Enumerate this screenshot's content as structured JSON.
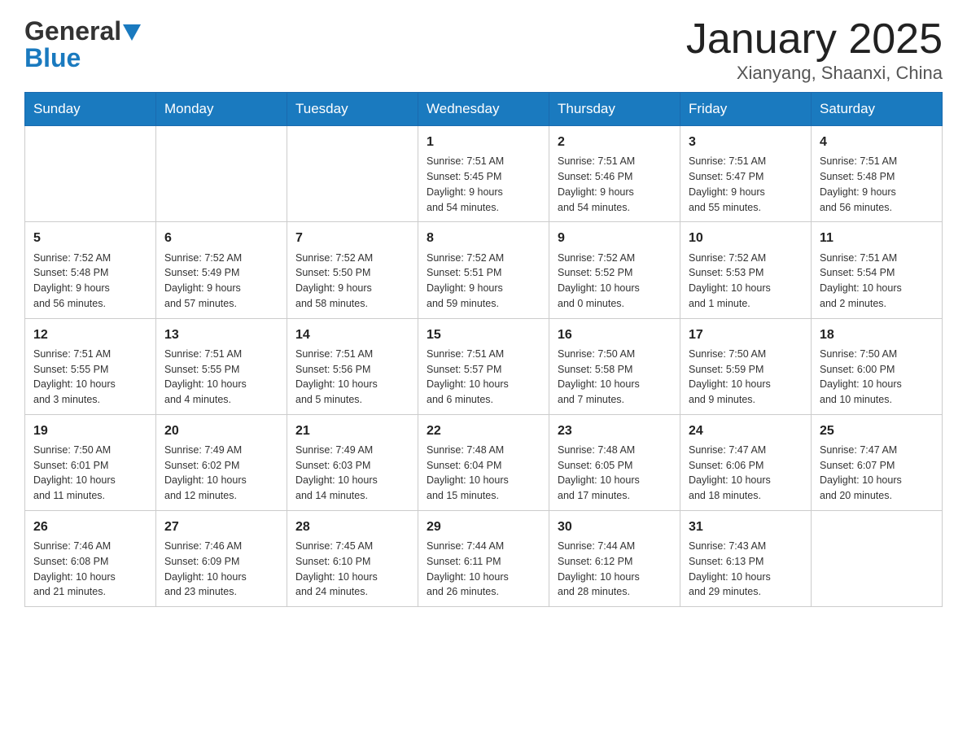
{
  "header": {
    "logo_general": "General",
    "logo_blue": "Blue",
    "title": "January 2025",
    "subtitle": "Xianyang, Shaanxi, China"
  },
  "days_of_week": [
    "Sunday",
    "Monday",
    "Tuesday",
    "Wednesday",
    "Thursday",
    "Friday",
    "Saturday"
  ],
  "weeks": [
    [
      {
        "day": "",
        "info": ""
      },
      {
        "day": "",
        "info": ""
      },
      {
        "day": "",
        "info": ""
      },
      {
        "day": "1",
        "info": "Sunrise: 7:51 AM\nSunset: 5:45 PM\nDaylight: 9 hours\nand 54 minutes."
      },
      {
        "day": "2",
        "info": "Sunrise: 7:51 AM\nSunset: 5:46 PM\nDaylight: 9 hours\nand 54 minutes."
      },
      {
        "day": "3",
        "info": "Sunrise: 7:51 AM\nSunset: 5:47 PM\nDaylight: 9 hours\nand 55 minutes."
      },
      {
        "day": "4",
        "info": "Sunrise: 7:51 AM\nSunset: 5:48 PM\nDaylight: 9 hours\nand 56 minutes."
      }
    ],
    [
      {
        "day": "5",
        "info": "Sunrise: 7:52 AM\nSunset: 5:48 PM\nDaylight: 9 hours\nand 56 minutes."
      },
      {
        "day": "6",
        "info": "Sunrise: 7:52 AM\nSunset: 5:49 PM\nDaylight: 9 hours\nand 57 minutes."
      },
      {
        "day": "7",
        "info": "Sunrise: 7:52 AM\nSunset: 5:50 PM\nDaylight: 9 hours\nand 58 minutes."
      },
      {
        "day": "8",
        "info": "Sunrise: 7:52 AM\nSunset: 5:51 PM\nDaylight: 9 hours\nand 59 minutes."
      },
      {
        "day": "9",
        "info": "Sunrise: 7:52 AM\nSunset: 5:52 PM\nDaylight: 10 hours\nand 0 minutes."
      },
      {
        "day": "10",
        "info": "Sunrise: 7:52 AM\nSunset: 5:53 PM\nDaylight: 10 hours\nand 1 minute."
      },
      {
        "day": "11",
        "info": "Sunrise: 7:51 AM\nSunset: 5:54 PM\nDaylight: 10 hours\nand 2 minutes."
      }
    ],
    [
      {
        "day": "12",
        "info": "Sunrise: 7:51 AM\nSunset: 5:55 PM\nDaylight: 10 hours\nand 3 minutes."
      },
      {
        "day": "13",
        "info": "Sunrise: 7:51 AM\nSunset: 5:55 PM\nDaylight: 10 hours\nand 4 minutes."
      },
      {
        "day": "14",
        "info": "Sunrise: 7:51 AM\nSunset: 5:56 PM\nDaylight: 10 hours\nand 5 minutes."
      },
      {
        "day": "15",
        "info": "Sunrise: 7:51 AM\nSunset: 5:57 PM\nDaylight: 10 hours\nand 6 minutes."
      },
      {
        "day": "16",
        "info": "Sunrise: 7:50 AM\nSunset: 5:58 PM\nDaylight: 10 hours\nand 7 minutes."
      },
      {
        "day": "17",
        "info": "Sunrise: 7:50 AM\nSunset: 5:59 PM\nDaylight: 10 hours\nand 9 minutes."
      },
      {
        "day": "18",
        "info": "Sunrise: 7:50 AM\nSunset: 6:00 PM\nDaylight: 10 hours\nand 10 minutes."
      }
    ],
    [
      {
        "day": "19",
        "info": "Sunrise: 7:50 AM\nSunset: 6:01 PM\nDaylight: 10 hours\nand 11 minutes."
      },
      {
        "day": "20",
        "info": "Sunrise: 7:49 AM\nSunset: 6:02 PM\nDaylight: 10 hours\nand 12 minutes."
      },
      {
        "day": "21",
        "info": "Sunrise: 7:49 AM\nSunset: 6:03 PM\nDaylight: 10 hours\nand 14 minutes."
      },
      {
        "day": "22",
        "info": "Sunrise: 7:48 AM\nSunset: 6:04 PM\nDaylight: 10 hours\nand 15 minutes."
      },
      {
        "day": "23",
        "info": "Sunrise: 7:48 AM\nSunset: 6:05 PM\nDaylight: 10 hours\nand 17 minutes."
      },
      {
        "day": "24",
        "info": "Sunrise: 7:47 AM\nSunset: 6:06 PM\nDaylight: 10 hours\nand 18 minutes."
      },
      {
        "day": "25",
        "info": "Sunrise: 7:47 AM\nSunset: 6:07 PM\nDaylight: 10 hours\nand 20 minutes."
      }
    ],
    [
      {
        "day": "26",
        "info": "Sunrise: 7:46 AM\nSunset: 6:08 PM\nDaylight: 10 hours\nand 21 minutes."
      },
      {
        "day": "27",
        "info": "Sunrise: 7:46 AM\nSunset: 6:09 PM\nDaylight: 10 hours\nand 23 minutes."
      },
      {
        "day": "28",
        "info": "Sunrise: 7:45 AM\nSunset: 6:10 PM\nDaylight: 10 hours\nand 24 minutes."
      },
      {
        "day": "29",
        "info": "Sunrise: 7:44 AM\nSunset: 6:11 PM\nDaylight: 10 hours\nand 26 minutes."
      },
      {
        "day": "30",
        "info": "Sunrise: 7:44 AM\nSunset: 6:12 PM\nDaylight: 10 hours\nand 28 minutes."
      },
      {
        "day": "31",
        "info": "Sunrise: 7:43 AM\nSunset: 6:13 PM\nDaylight: 10 hours\nand 29 minutes."
      },
      {
        "day": "",
        "info": ""
      }
    ]
  ]
}
